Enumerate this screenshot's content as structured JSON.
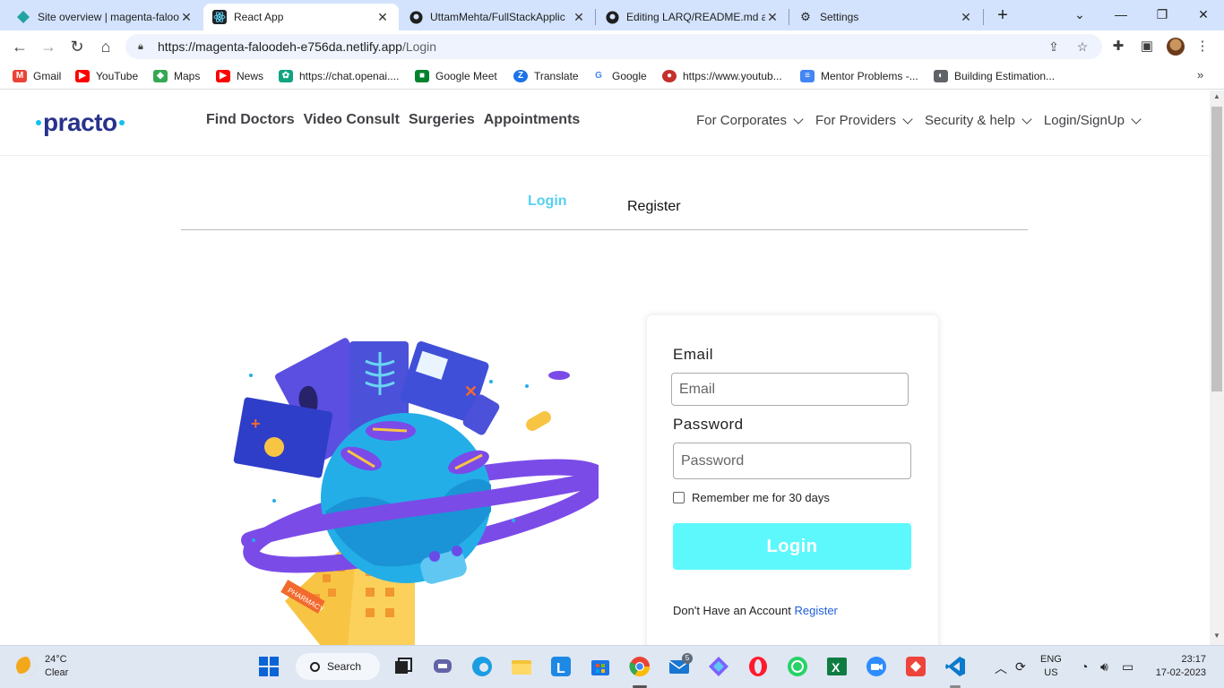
{
  "browser": {
    "tabs": [
      {
        "title": "Site overview | magenta-faloo",
        "active": false,
        "icon": "netlify-icon"
      },
      {
        "title": "React App",
        "active": true,
        "icon": "react-icon"
      },
      {
        "title": "UttamMehta/FullStackApplic",
        "active": false,
        "icon": "github-icon"
      },
      {
        "title": "Editing LARQ/README.md at",
        "active": false,
        "icon": "github-icon"
      },
      {
        "title": "Settings",
        "active": false,
        "icon": "gear-icon"
      }
    ],
    "url_host": "https://magenta-faloodeh-e756da.netlify.app",
    "url_path": "/Login",
    "bookmarks": [
      {
        "label": "Gmail",
        "color": "#ea4335"
      },
      {
        "label": "YouTube",
        "color": "#ff0000"
      },
      {
        "label": "Maps",
        "color": "#34a853"
      },
      {
        "label": "News",
        "color": "#ff0000"
      },
      {
        "label": "https://chat.openai....",
        "color": "#10a37f"
      },
      {
        "label": "Google Meet",
        "color": "#00832d"
      },
      {
        "label": "Translate",
        "color": "#1a73e8"
      },
      {
        "label": "Google",
        "color": "#4285f4"
      },
      {
        "label": "https://www.youtub...",
        "color": "#c4302b"
      },
      {
        "label": "Mentor Problems -...",
        "color": "#4285f4"
      },
      {
        "label": "Building Estimation...",
        "color": "#5f6368"
      }
    ]
  },
  "site": {
    "logo_text": "practo",
    "main_nav": [
      "Find Doctors",
      "Video Consult",
      "Surgeries",
      "Appointments"
    ],
    "right_nav": [
      "For Corporates",
      "For Providers",
      "Security & help",
      "Login/SignUp"
    ],
    "auth_tabs": {
      "login": "Login",
      "register": "Register"
    },
    "form": {
      "email_label": "Email",
      "email_placeholder": "Email",
      "password_label": "Password",
      "password_placeholder": "Password",
      "remember_label": "Remember me for 30 days",
      "submit_label": "Login",
      "no_account_text": "Don't Have an Account",
      "register_link": "Register"
    },
    "colors": {
      "brand": "#28328c",
      "accent": "#14bef0",
      "button": "#5df8fc"
    }
  },
  "taskbar": {
    "temperature": "24°C",
    "condition": "Clear",
    "search_label": "Search",
    "language": "ENG",
    "region": "US",
    "time": "23:17",
    "date": "17-02-2023",
    "mail_badge": "5",
    "apps": [
      "windows-start-icon",
      "task-view-icon",
      "teams-chat-icon",
      "edge-icon",
      "file-explorer-icon",
      "l-app-icon",
      "store-icon",
      "chrome-icon",
      "mail-icon",
      "copilot-icon",
      "opera-icon",
      "whatsapp-icon",
      "excel-icon",
      "zoom-icon",
      "anydesk-icon",
      "vscode-icon"
    ]
  }
}
